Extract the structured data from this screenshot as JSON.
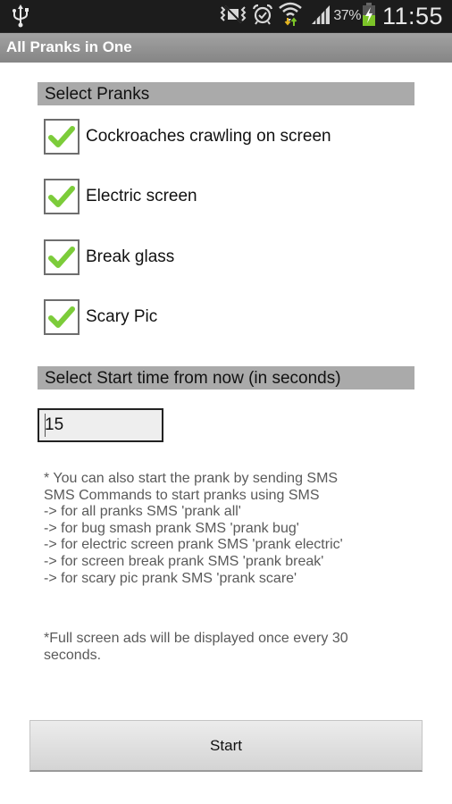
{
  "status_bar": {
    "icons": [
      "usb-icon",
      "silent-mode-icon",
      "alarm-icon",
      "wifi-icon",
      "signal-icon",
      "battery-charging-icon"
    ],
    "battery_percent": "37%",
    "time": "11:55",
    "battery_color": "#7cc428"
  },
  "app": {
    "title": "All Pranks in One"
  },
  "pranks_section": {
    "header": "Select Pranks",
    "items": [
      {
        "label": "Cockroaches crawling on screen",
        "checked": true
      },
      {
        "label": "Electric screen",
        "checked": true
      },
      {
        "label": "Break glass",
        "checked": true
      },
      {
        "label": "Scary Pic",
        "checked": true
      }
    ],
    "check_color": "#7ccc3a"
  },
  "time_section": {
    "header": "Select Start time from now (in seconds)",
    "value": "15"
  },
  "info": {
    "lines": [
      "* You can also start the prank by sending SMS",
      "SMS Commands to start pranks using SMS",
      "-> for all pranks SMS 'prank all'",
      "-> for bug smash prank SMS 'prank bug'",
      "-> for electric screen prank SMS 'prank electric'",
      "-> for screen break prank SMS 'prank break'",
      "-> for scary pic prank SMS 'prank scare'"
    ],
    "ads_note": "*Full screen ads will be displayed once every 30 seconds."
  },
  "actions": {
    "start_label": "Start"
  }
}
